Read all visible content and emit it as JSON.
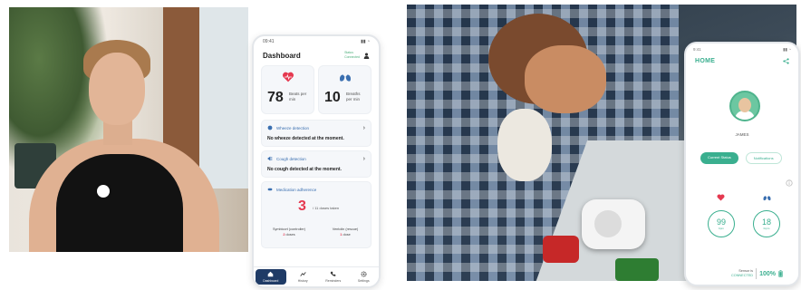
{
  "phone1": {
    "status_time": "09:41",
    "title": "Dashboard",
    "header_status": [
      "Status",
      "Connected"
    ],
    "heart_card": {
      "value": "78",
      "unit": "Beats per min"
    },
    "lungs_card": {
      "value": "10",
      "unit": "Breaths per min"
    },
    "wheeze": {
      "label": "Wheeze detection",
      "message": "No wheeze detected at the moment."
    },
    "cough": {
      "label": "Cough detection",
      "message": "No cough detected at the moment."
    },
    "medication": {
      "label": "Medication adherence",
      "value": "3",
      "suffix": "/ 11 doses taken",
      "symbicort": {
        "label": "Symbicort (controller)",
        "value": "2",
        "suffix": "doses"
      },
      "ventolin": {
        "label": "Ventolin (rescue)",
        "value": "1",
        "suffix": "dose"
      }
    },
    "nav": [
      "Dashboard",
      "History",
      "Reminders",
      "Settings"
    ]
  },
  "phone2": {
    "status_time": "9:41",
    "title": "HOME",
    "name": "JAMES",
    "tabs": [
      "Current Status",
      "Notifications"
    ],
    "heart": {
      "value": "99",
      "unit": "bpm"
    },
    "lungs": {
      "value": "18",
      "unit": "brpm"
    },
    "sensor_label": "Sensor is",
    "sensor_status": "CONNECTED",
    "battery": "100%"
  },
  "colors": {
    "heart_red": "#e53950",
    "lung_blue": "#3a6fb0",
    "accent_green": "#3aaf8f",
    "nav_active": "#1f3b66"
  }
}
